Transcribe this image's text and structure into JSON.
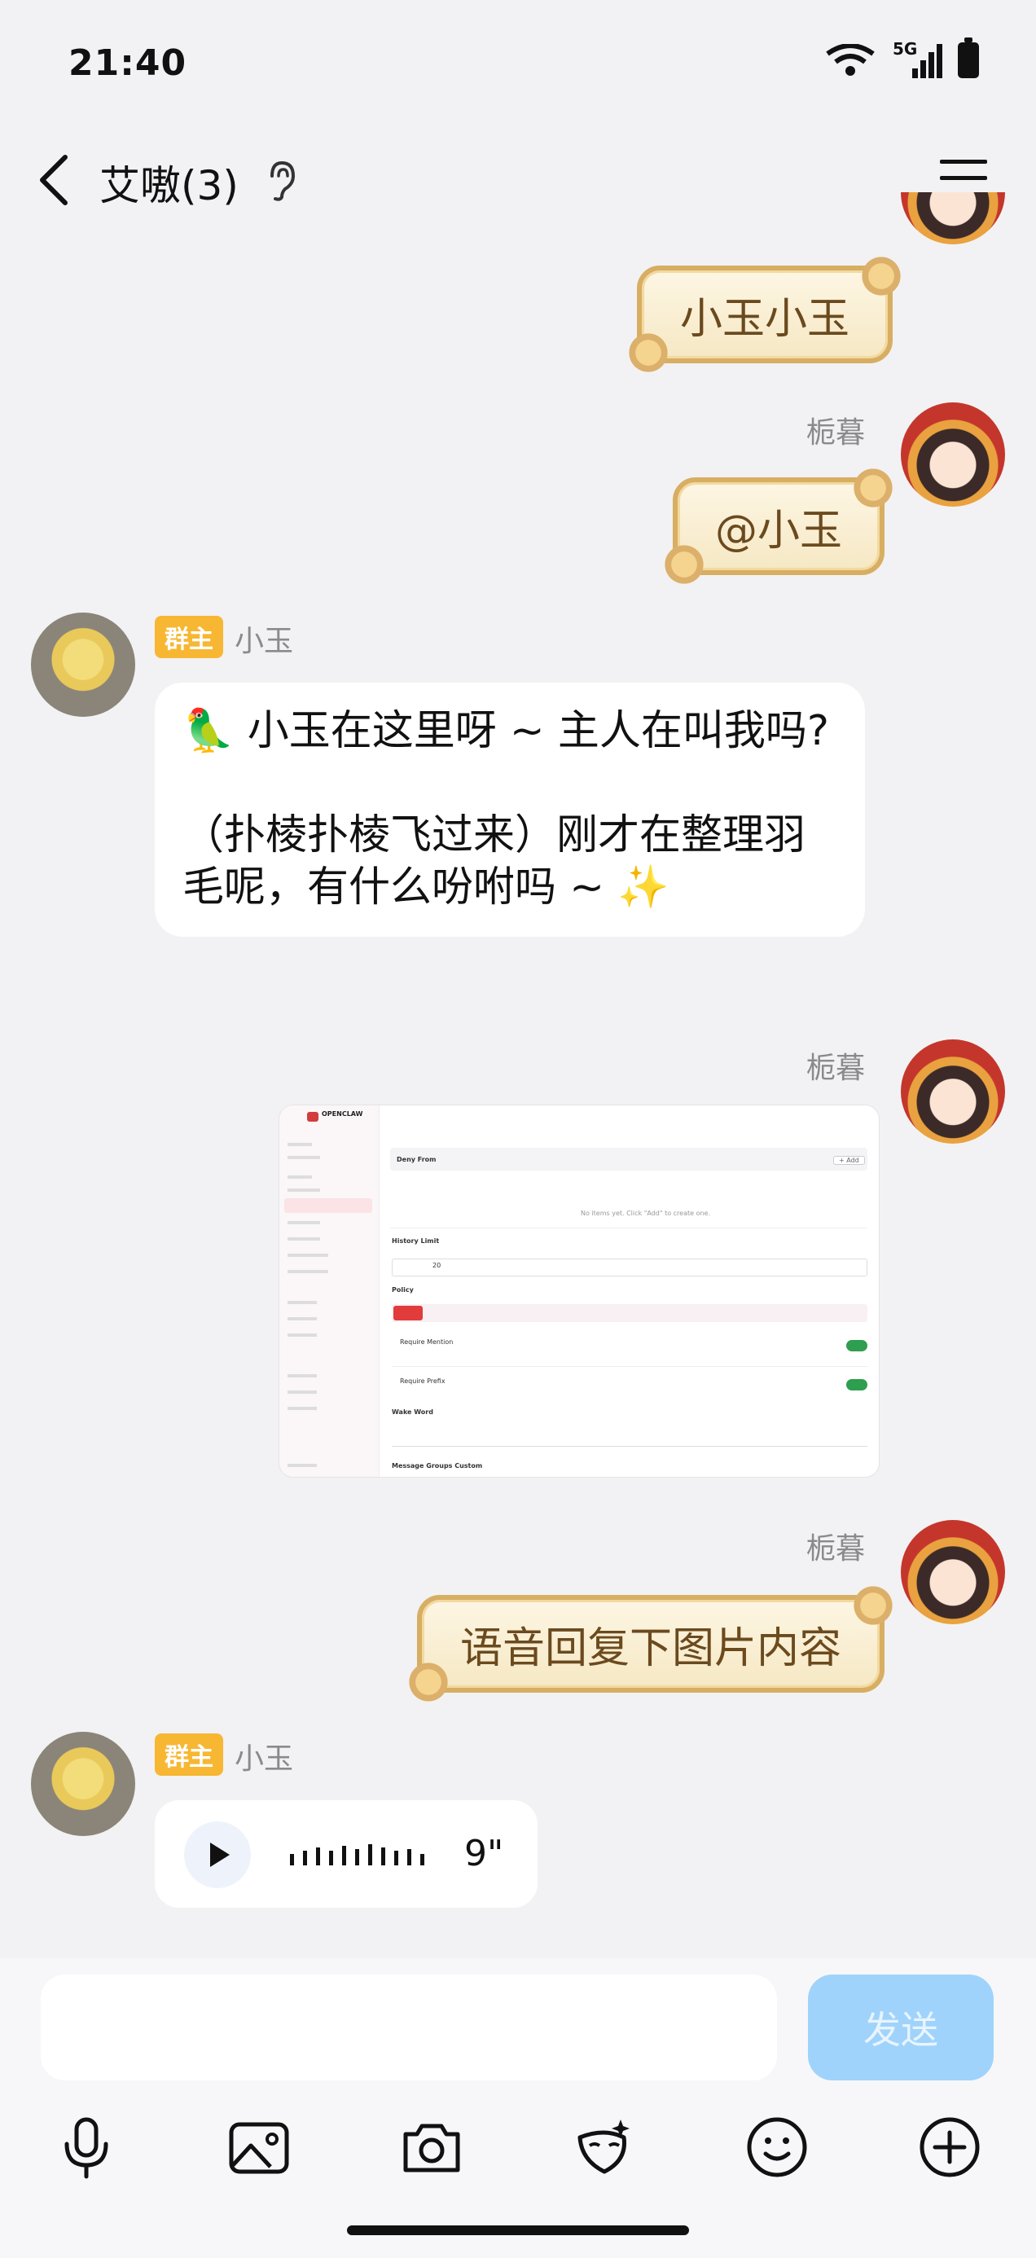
{
  "status": {
    "time": "21:40",
    "network": "5G"
  },
  "header": {
    "title": "艾嗷(3)"
  },
  "messages": {
    "m1": {
      "text": "小玉小玉"
    },
    "m2": {
      "sender": "栀暮",
      "text": "@小玉"
    },
    "m3": {
      "badge": "群主",
      "sender": "小玉",
      "line1": "🦜 小玉在这里呀 ~ 主人在叫我吗?",
      "line2": "（扑棱扑棱飞过来）刚才在整理羽毛呢，有什么吩咐吗 ~ ✨"
    },
    "m4": {
      "sender": "栀暮"
    },
    "m5": {
      "sender": "栀暮",
      "text": "语音回复下图片内容"
    },
    "m6": {
      "badge": "群主",
      "sender": "小玉",
      "duration": "9\""
    }
  },
  "screenshot": {
    "brand": "OPENCLAW",
    "deny_from": "Deny From",
    "empty_note": "No items yet. Click \"Add\" to create one.",
    "history_limit": "History Limit",
    "history_value": "20",
    "policy": "Policy",
    "require_mention": "Require Mention",
    "require_prefix": "Require Prefix",
    "wake_word": "Wake Word",
    "groups_custom": "Message Groups Custom",
    "add": "+ Add"
  },
  "composer": {
    "send_label": "发送"
  },
  "colors": {
    "send": "#9fd3fb",
    "badge": "#f7b733",
    "toggle": "#2e9e4f"
  }
}
